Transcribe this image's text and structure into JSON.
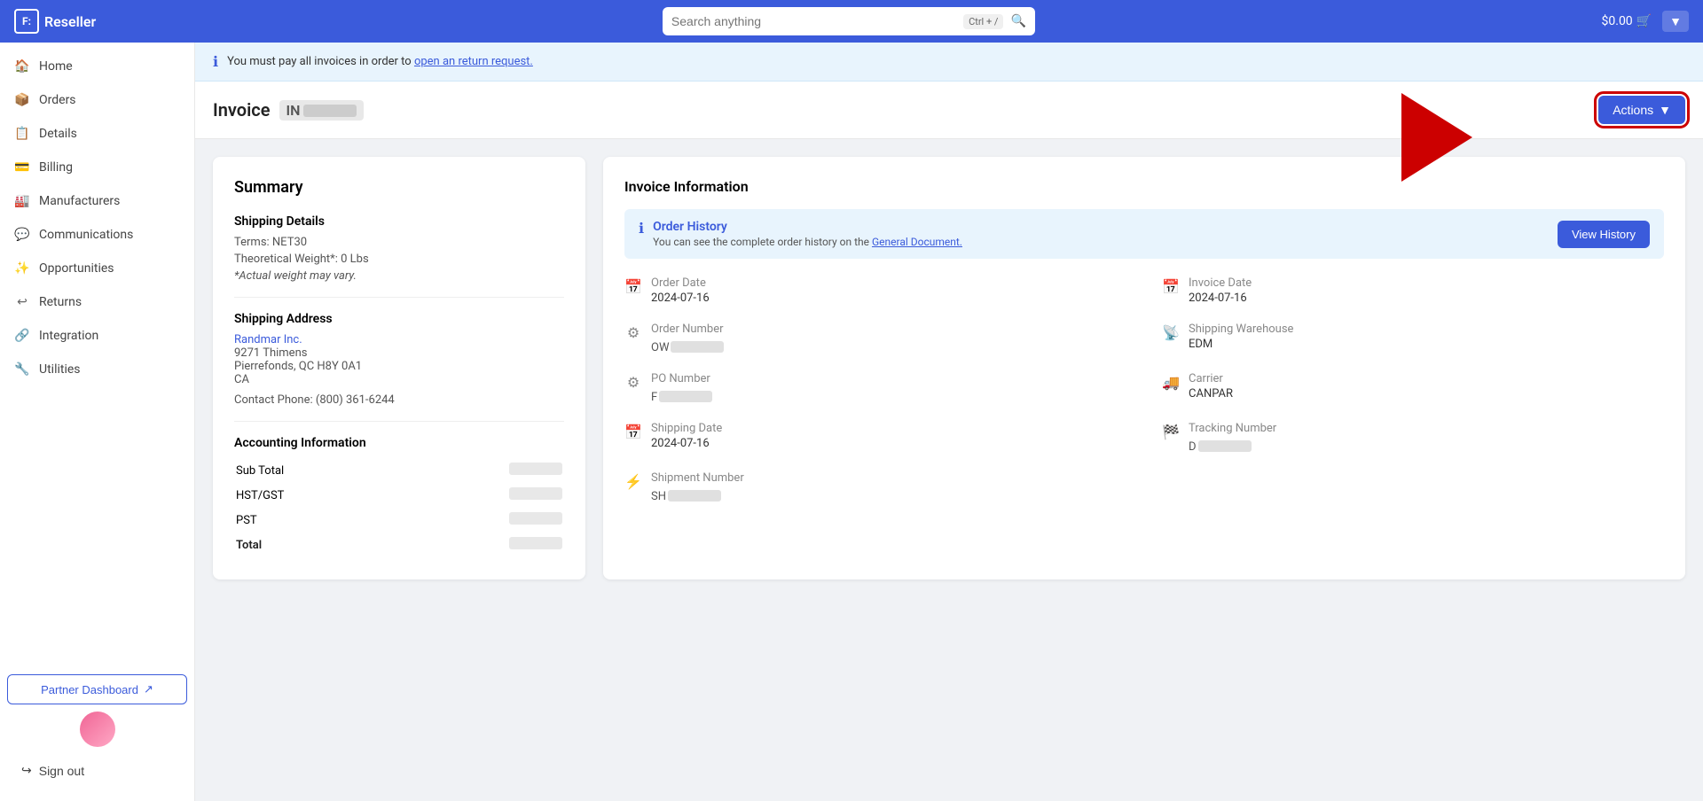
{
  "app": {
    "name": "Reseller"
  },
  "topnav": {
    "search_placeholder": "Search anything",
    "search_shortcut": "Ctrl + /",
    "cart_amount": "$0.00"
  },
  "sidebar": {
    "items": [
      {
        "id": "home",
        "label": "Home",
        "icon": "🏠"
      },
      {
        "id": "orders",
        "label": "Orders",
        "icon": "📦"
      },
      {
        "id": "details",
        "label": "Details",
        "icon": "📋"
      },
      {
        "id": "billing",
        "label": "Billing",
        "icon": "💳"
      },
      {
        "id": "manufacturers",
        "label": "Manufacturers",
        "icon": "🏭"
      },
      {
        "id": "communications",
        "label": "Communications",
        "icon": "💬"
      },
      {
        "id": "opportunities",
        "label": "Opportunities",
        "icon": "✨"
      },
      {
        "id": "returns",
        "label": "Returns",
        "icon": "↩"
      },
      {
        "id": "integration",
        "label": "Integration",
        "icon": "🔗"
      },
      {
        "id": "utilities",
        "label": "Utilities",
        "icon": "🔧"
      }
    ],
    "partner_dashboard": "Partner Dashboard",
    "sign_out": "Sign out"
  },
  "notice": {
    "text": "You must pay all invoices in order to",
    "link_text": "open an return request.",
    "full": "You must pay all invoices in order to open an return request."
  },
  "invoice": {
    "label": "Invoice",
    "id_placeholder": "IN",
    "actions_button": "Actions"
  },
  "summary": {
    "title": "Summary",
    "shipping_details_title": "Shipping Details",
    "terms": "Terms: NET30",
    "theoretical_weight": "Theoretical Weight*: 0 Lbs",
    "weight_note": "*Actual weight may vary.",
    "shipping_address_title": "Shipping Address",
    "company_name": "Randmar Inc.",
    "address1": "9271 Thimens",
    "address2": "Pierrefonds, QC H8Y 0A1",
    "country": "CA",
    "contact_phone": "Contact Phone: (800) 361-6244",
    "accounting_title": "Accounting Information",
    "sub_total_label": "Sub Total",
    "hst_gst_label": "HST/GST",
    "pst_label": "PST",
    "total_label": "Total"
  },
  "invoice_info": {
    "title": "Invoice Information",
    "order_history_title": "Order History",
    "order_history_desc": "You can see the complete order history on the",
    "order_history_link": "General Document.",
    "view_history_button": "View History",
    "fields": [
      {
        "id": "order-date",
        "label": "Order Date",
        "value": "2024-07-16",
        "icon": "📅",
        "masked": false
      },
      {
        "id": "invoice-date",
        "label": "Invoice Date",
        "value": "2024-07-16",
        "icon": "📅",
        "masked": false
      },
      {
        "id": "order-number",
        "label": "Order Number",
        "value": "OW",
        "icon": "⚙",
        "masked": true
      },
      {
        "id": "shipping-warehouse",
        "label": "Shipping Warehouse",
        "value": "EDM",
        "icon": "📡",
        "masked": false
      },
      {
        "id": "po-number",
        "label": "PO Number",
        "value": "F",
        "icon": "⚙",
        "masked": true
      },
      {
        "id": "carrier",
        "label": "Carrier",
        "value": "CANPAR",
        "icon": "🚚",
        "masked": false
      },
      {
        "id": "shipping-date",
        "label": "Shipping Date",
        "value": "2024-07-16",
        "icon": "📅",
        "masked": false
      },
      {
        "id": "tracking-number",
        "label": "Tracking Number",
        "value": "D",
        "icon": "🏁",
        "masked": true
      },
      {
        "id": "shipment-number",
        "label": "Shipment Number",
        "value": "SH",
        "icon": "⚡",
        "masked": true
      }
    ]
  },
  "colors": {
    "primary": "#3b5bdb",
    "danger": "#cc0000"
  }
}
